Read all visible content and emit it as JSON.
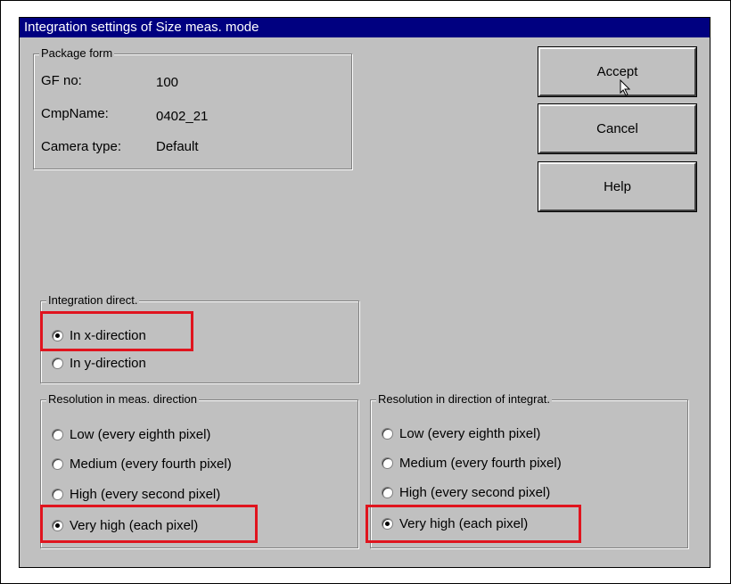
{
  "window": {
    "title": "Integration settings of Size meas. mode"
  },
  "package_form": {
    "label": "Package form",
    "gf_no_label": "GF no:",
    "gf_no_value": "100",
    "cmp_name_label": "CmpName:",
    "cmp_name_value": "0402_21",
    "camera_type_label": "Camera type:",
    "camera_type_value": "Default"
  },
  "buttons": {
    "accept": "Accept",
    "cancel": "Cancel",
    "help": "Help"
  },
  "integration_direct": {
    "label": "Integration direct.",
    "options": [
      "In x-direction",
      "In y-direction"
    ],
    "selected": "In x-direction"
  },
  "resolution_meas": {
    "label": "Resolution in meas. direction",
    "options": [
      "Low (every eighth pixel)",
      "Medium (every fourth pixel)",
      "High (every second pixel)",
      "Very high (each pixel)"
    ],
    "selected": "Very high (each pixel)"
  },
  "resolution_integrat": {
    "label": "Resolution in direction of integrat.",
    "options": [
      "Low (every eighth pixel)",
      "Medium (every fourth pixel)",
      "High (every second pixel)",
      "Very high (each pixel)"
    ],
    "selected": "Very high (each pixel)"
  },
  "colors": {
    "titlebar": "#000080",
    "dialog_bg": "#c0c0c0",
    "highlight": "#e0141e"
  },
  "icons": {
    "cursor": "mouse-pointer-icon"
  }
}
